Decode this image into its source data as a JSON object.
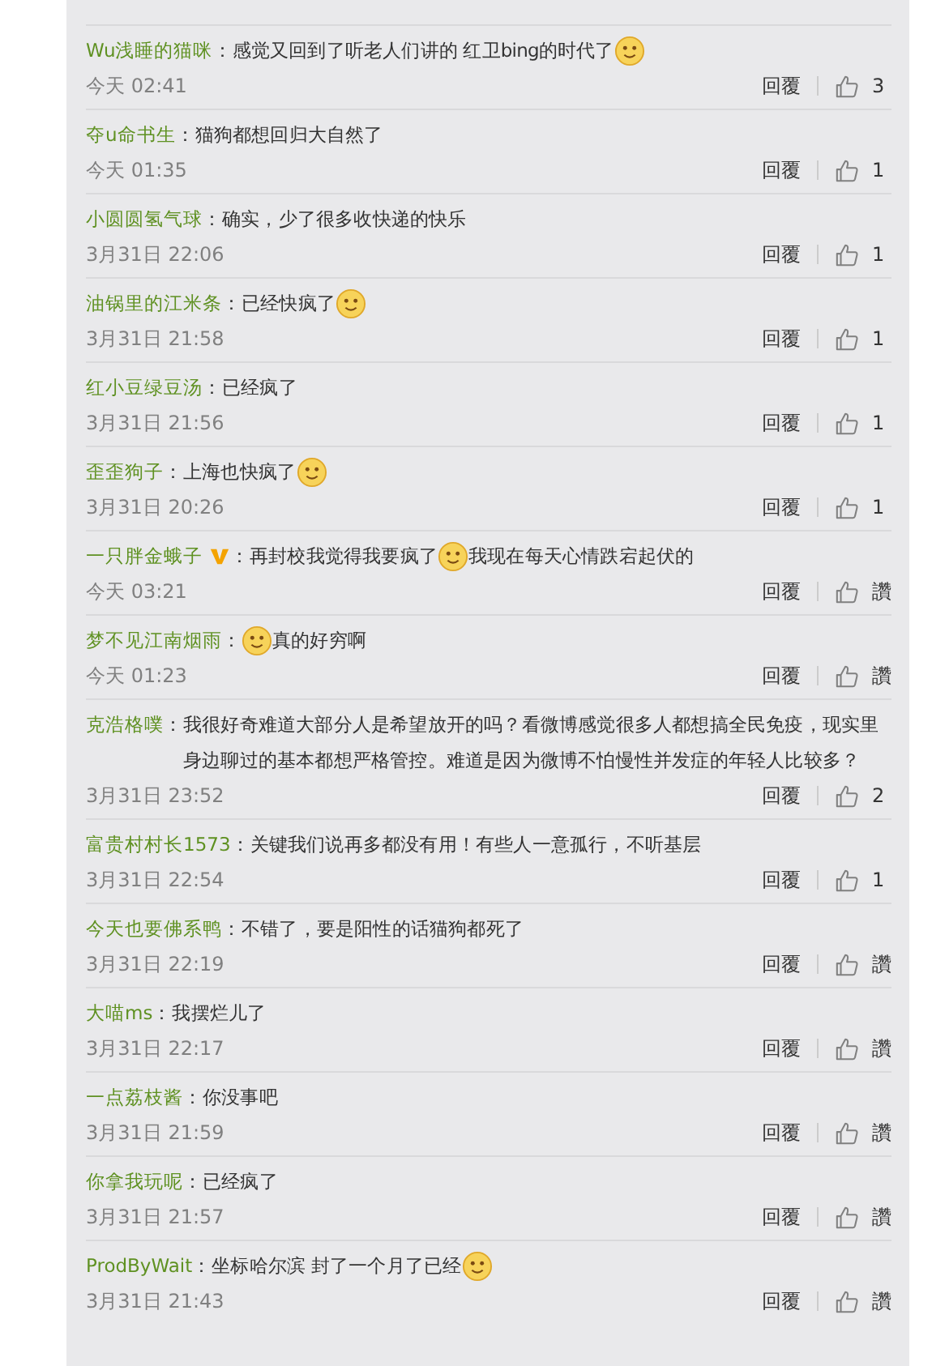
{
  "comments": [
    {
      "user": "Wu浅睡的猫咪",
      "verified": false,
      "separator": "：",
      "content": [
        {
          "kind": "text",
          "text": "感觉又回到了听老人们讲的 红卫bing的时代了"
        },
        {
          "kind": "emoji"
        }
      ],
      "time": "今天 02:41",
      "reply": "回覆",
      "likes": "3"
    },
    {
      "user": "夺u命书生",
      "verified": false,
      "separator": "：",
      "content": [
        {
          "kind": "text",
          "text": "猫狗都想回归大自然了"
        }
      ],
      "time": "今天 01:35",
      "reply": "回覆",
      "likes": "1"
    },
    {
      "user": "小圆圆氢气球",
      "verified": false,
      "separator": "：",
      "content": [
        {
          "kind": "text",
          "text": "确实，少了很多收快递的快乐"
        }
      ],
      "time": "3月31日 22:06",
      "reply": "回覆",
      "likes": "1"
    },
    {
      "user": "油锅里的江米条",
      "verified": false,
      "separator": "：",
      "content": [
        {
          "kind": "text",
          "text": "已经快疯了"
        },
        {
          "kind": "emoji"
        }
      ],
      "time": "3月31日 21:58",
      "reply": "回覆",
      "likes": "1"
    },
    {
      "user": "红小豆绿豆汤",
      "verified": false,
      "separator": "：",
      "content": [
        {
          "kind": "text",
          "text": "已经疯了"
        }
      ],
      "time": "3月31日 21:56",
      "reply": "回覆",
      "likes": "1"
    },
    {
      "user": "歪歪狗子",
      "verified": false,
      "separator": "：",
      "content": [
        {
          "kind": "text",
          "text": "上海也快疯了"
        },
        {
          "kind": "emoji"
        }
      ],
      "time": "3月31日 20:26",
      "reply": "回覆",
      "likes": "1"
    },
    {
      "user": "一只胖金蛾子",
      "verified": true,
      "separator": "：",
      "content": [
        {
          "kind": "text",
          "text": "再封校我觉得我要疯了"
        },
        {
          "kind": "emoji"
        },
        {
          "kind": "text",
          "text": "我现在每天心情跌宕起伏的"
        }
      ],
      "time": "今天 03:21",
      "reply": "回覆",
      "likes": "讚"
    },
    {
      "user": "梦不见江南烟雨",
      "verified": false,
      "separator": "：",
      "content": [
        {
          "kind": "emoji"
        },
        {
          "kind": "text",
          "text": "真的好穷啊"
        }
      ],
      "time": "今天 01:23",
      "reply": "回覆",
      "likes": "讚"
    },
    {
      "user": "克浩格噗",
      "verified": false,
      "separator": "：",
      "content": [
        {
          "kind": "text",
          "text": "我很好奇难道大部分人是希望放开的吗？看微博感觉很多人都想搞全民免疫，现实里身边聊过的基本都想严格管控。难道是因为微博不怕慢性并发症的年轻人比较多？"
        }
      ],
      "time": "3月31日 23:52",
      "reply": "回覆",
      "likes": "2"
    },
    {
      "user": "富贵村村长1573",
      "verified": false,
      "separator": "：",
      "content": [
        {
          "kind": "text",
          "text": "关键我们说再多都没有用！有些人一意孤行，不听基层"
        }
      ],
      "time": "3月31日 22:54",
      "reply": "回覆",
      "likes": "1"
    },
    {
      "user": "今天也要佛系鸭",
      "verified": false,
      "separator": "：",
      "content": [
        {
          "kind": "text",
          "text": "不错了，要是阳性的话猫狗都死了"
        }
      ],
      "time": "3月31日 22:19",
      "reply": "回覆",
      "likes": "讚"
    },
    {
      "user": "大喵ms",
      "verified": false,
      "separator": "：",
      "content": [
        {
          "kind": "text",
          "text": "我摆烂儿了"
        }
      ],
      "time": "3月31日 22:17",
      "reply": "回覆",
      "likes": "讚"
    },
    {
      "user": "一点荔枝酱",
      "verified": false,
      "separator": "：",
      "content": [
        {
          "kind": "text",
          "text": "你没事吧"
        }
      ],
      "time": "3月31日 21:59",
      "reply": "回覆",
      "likes": "讚"
    },
    {
      "user": "你拿我玩呢",
      "verified": false,
      "separator": "：",
      "content": [
        {
          "kind": "text",
          "text": "已经疯了"
        }
      ],
      "time": "3月31日 21:57",
      "reply": "回覆",
      "likes": "讚"
    },
    {
      "user": "ProdByWait",
      "verified": false,
      "separator": "：",
      "content": [
        {
          "kind": "text",
          "text": "坐标哈尔滨 封了一个月了已经"
        },
        {
          "kind": "emoji"
        }
      ],
      "time": "3月31日 21:43",
      "reply": "回覆",
      "likes": "讚"
    }
  ]
}
